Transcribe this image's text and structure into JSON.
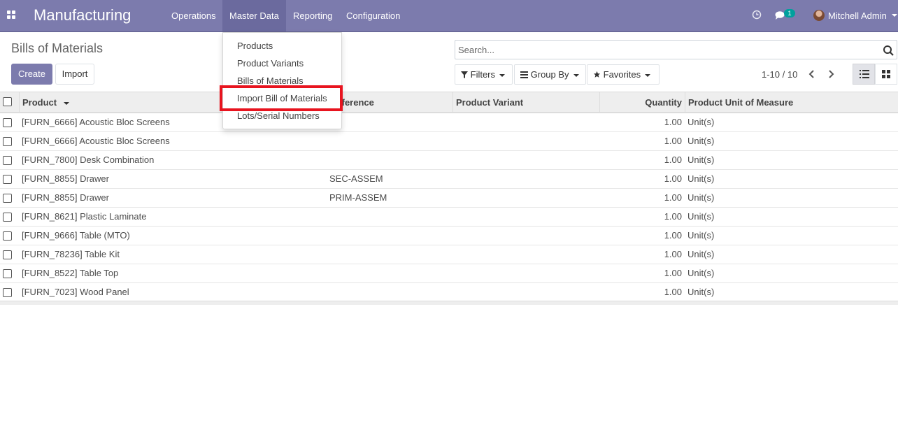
{
  "navbar": {
    "app_name": "Manufacturing",
    "menus": [
      "Operations",
      "Master Data",
      "Reporting",
      "Configuration"
    ],
    "active_menu": "Master Data",
    "message_count": "1",
    "user_name": "Mitchell Admin"
  },
  "control_panel": {
    "title": "Bills of Materials",
    "create_label": "Create",
    "import_label": "Import",
    "search_placeholder": "Search...",
    "filters_label": "Filters",
    "groupby_label": "Group By",
    "favorites_label": "Favorites",
    "pager": "1-10 / 10"
  },
  "table": {
    "headers": {
      "product": "Product",
      "reference": "Reference",
      "variant": "Product Variant",
      "quantity": "Quantity",
      "uom": "Product Unit of Measure"
    },
    "rows": [
      {
        "product": "[FURN_6666] Acoustic Bloc Screens",
        "reference": "",
        "variant": "",
        "quantity": "1.00",
        "uom": "Unit(s)"
      },
      {
        "product": "[FURN_6666] Acoustic Bloc Screens",
        "reference": "",
        "variant": "",
        "quantity": "1.00",
        "uom": "Unit(s)"
      },
      {
        "product": "[FURN_7800] Desk Combination",
        "reference": "",
        "variant": "",
        "quantity": "1.00",
        "uom": "Unit(s)"
      },
      {
        "product": "[FURN_8855] Drawer",
        "reference": "SEC-ASSEM",
        "variant": "",
        "quantity": "1.00",
        "uom": "Unit(s)"
      },
      {
        "product": "[FURN_8855] Drawer",
        "reference": "PRIM-ASSEM",
        "variant": "",
        "quantity": "1.00",
        "uom": "Unit(s)"
      },
      {
        "product": "[FURN_8621] Plastic Laminate",
        "reference": "",
        "variant": "",
        "quantity": "1.00",
        "uom": "Unit(s)"
      },
      {
        "product": "[FURN_9666] Table (MTO)",
        "reference": "",
        "variant": "",
        "quantity": "1.00",
        "uom": "Unit(s)"
      },
      {
        "product": "[FURN_78236] Table Kit",
        "reference": "",
        "variant": "",
        "quantity": "1.00",
        "uom": "Unit(s)"
      },
      {
        "product": "[FURN_8522] Table Top",
        "reference": "",
        "variant": "",
        "quantity": "1.00",
        "uom": "Unit(s)"
      },
      {
        "product": "[FURN_7023] Wood Panel",
        "reference": "",
        "variant": "",
        "quantity": "1.00",
        "uom": "Unit(s)"
      }
    ]
  },
  "dropdown": {
    "items": [
      "Products",
      "Product Variants",
      "Bills of Materials",
      "Import Bill of Materials",
      "Lots/Serial Numbers"
    ],
    "highlighted": "Import Bill of Materials"
  },
  "colors": {
    "navbar": "#7c7bad",
    "primary_button": "#7c7bad",
    "highlight_box": "#e8141f",
    "badge": "#00a09d"
  }
}
